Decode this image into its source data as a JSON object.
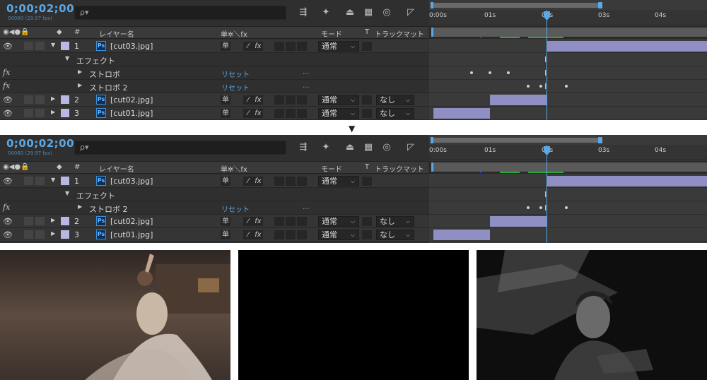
{
  "timecode": "0;00;02;00",
  "fps": "00060 (29.97 fps)",
  "search_glyph": "ρ▾",
  "columns": {
    "num": "#",
    "layer_name": "レイヤー名",
    "switches": "单✲＼fx",
    "mode": "モード",
    "t": "T",
    "trackmatte": "トラックマット"
  },
  "ruler": [
    "0:00s",
    "01s",
    "02s",
    "03s",
    "04s"
  ],
  "top_panel": {
    "layers": [
      {
        "num": "1",
        "name": "[cut03.jpg]",
        "mode": "通常",
        "trackmatte": ""
      },
      {
        "num": "2",
        "name": "[cut02.jpg]",
        "mode": "通常",
        "trackmatte": "なし"
      },
      {
        "num": "3",
        "name": "[cut01.jpg]",
        "mode": "通常",
        "trackmatte": "なし"
      }
    ],
    "effects_label": "エフェクト",
    "effects": [
      {
        "name": "ストロボ",
        "reset": "リセット",
        "more": "..."
      },
      {
        "name": "ストロボ 2",
        "reset": "リセット",
        "more": "..."
      }
    ]
  },
  "bottom_panel": {
    "layers": [
      {
        "num": "1",
        "name": "[cut03.jpg]",
        "mode": "通常",
        "trackmatte": ""
      },
      {
        "num": "2",
        "name": "[cut02.jpg]",
        "mode": "通常",
        "trackmatte": "なし"
      },
      {
        "num": "3",
        "name": "[cut01.jpg]",
        "mode": "通常",
        "trackmatte": "なし"
      }
    ],
    "effects_label": "エフェクト",
    "effects": [
      {
        "name": "ストロボ 2",
        "reset": "リセット",
        "more": "..."
      }
    ]
  },
  "arrow": "▼",
  "icons": {
    "ps_badge": "Ps",
    "fx_glyph": "fx",
    "eye": "eye-icon",
    "solo_pickwhip": "单"
  },
  "colors": {
    "accent": "#5aa8e6",
    "layer_bar": "#8f8fc4",
    "label_lavender": "#b8b8e0",
    "work_green": "#2fa83a"
  }
}
